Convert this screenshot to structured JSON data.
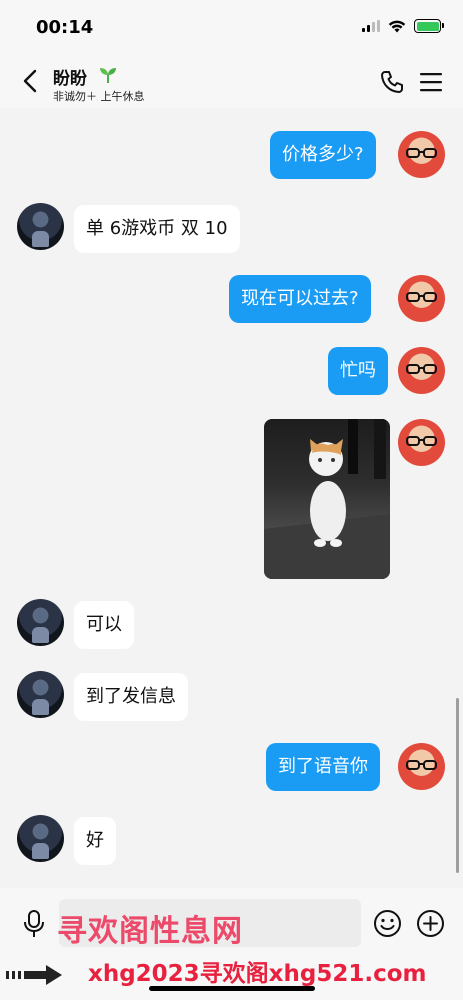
{
  "status_bar": {
    "time": "00:14",
    "battery_color": "#34c759"
  },
  "header": {
    "name": "盼盼",
    "substatus": "非诚勿＋ 上午休息",
    "icons": [
      "chevron-left-icon",
      "sprout-icon",
      "phone-icon",
      "menu-icon"
    ]
  },
  "messages": [
    {
      "from": "me",
      "text": "价格多少?"
    },
    {
      "from": "other",
      "text": "单 6游戏币  双 10"
    },
    {
      "from": "me",
      "text": "现在可以过去?"
    },
    {
      "from": "me",
      "text": "忙吗"
    },
    {
      "from": "me",
      "type": "image",
      "image_desc": "cat-photo"
    },
    {
      "from": "other",
      "text": "可以"
    },
    {
      "from": "other",
      "text": "到了发信息"
    },
    {
      "from": "me",
      "text": "到了语音你"
    },
    {
      "from": "other",
      "text": "好"
    }
  ],
  "input_bar": {
    "icons": [
      "microphone-icon",
      "emoji-icon",
      "plus-icon"
    ]
  },
  "watermark": {
    "line1": "寻欢阁性息网",
    "line2": "xhg2023寻欢阁xhg521.com"
  },
  "colors": {
    "my_bubble": "#1a9cf5",
    "other_bubble": "#ffffff",
    "background": "#f3f3f3"
  }
}
